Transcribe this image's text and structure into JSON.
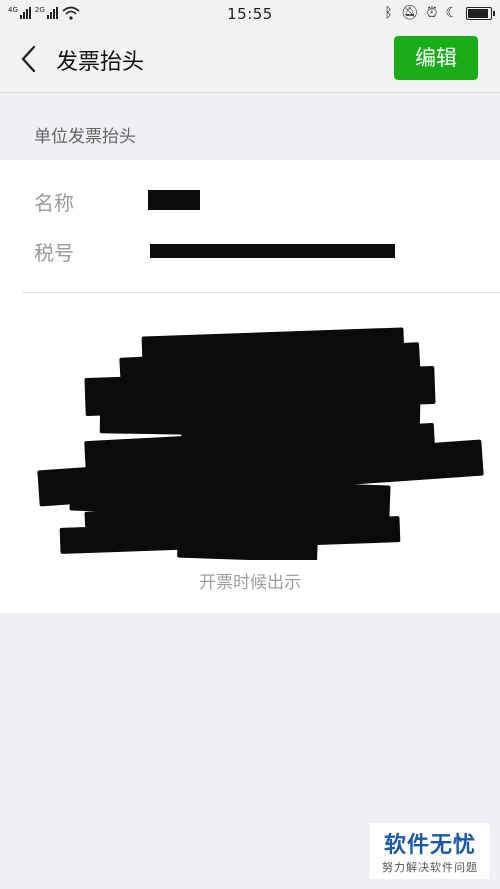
{
  "status_bar": {
    "time": "15:55",
    "signal1": "4G",
    "signal2": "2G"
  },
  "nav": {
    "title": "发票抬头",
    "edit_label": "编辑"
  },
  "section": {
    "header": "单位发票抬头"
  },
  "fields": {
    "name_label": "名称",
    "tax_label": "税号",
    "name_value": "",
    "tax_value": ""
  },
  "caption": "开票时候出示",
  "watermark": {
    "title": "软件无忧",
    "subtitle": "努力解决软件问题"
  },
  "colors": {
    "accent": "#1aad19",
    "background": "#efeff4"
  }
}
